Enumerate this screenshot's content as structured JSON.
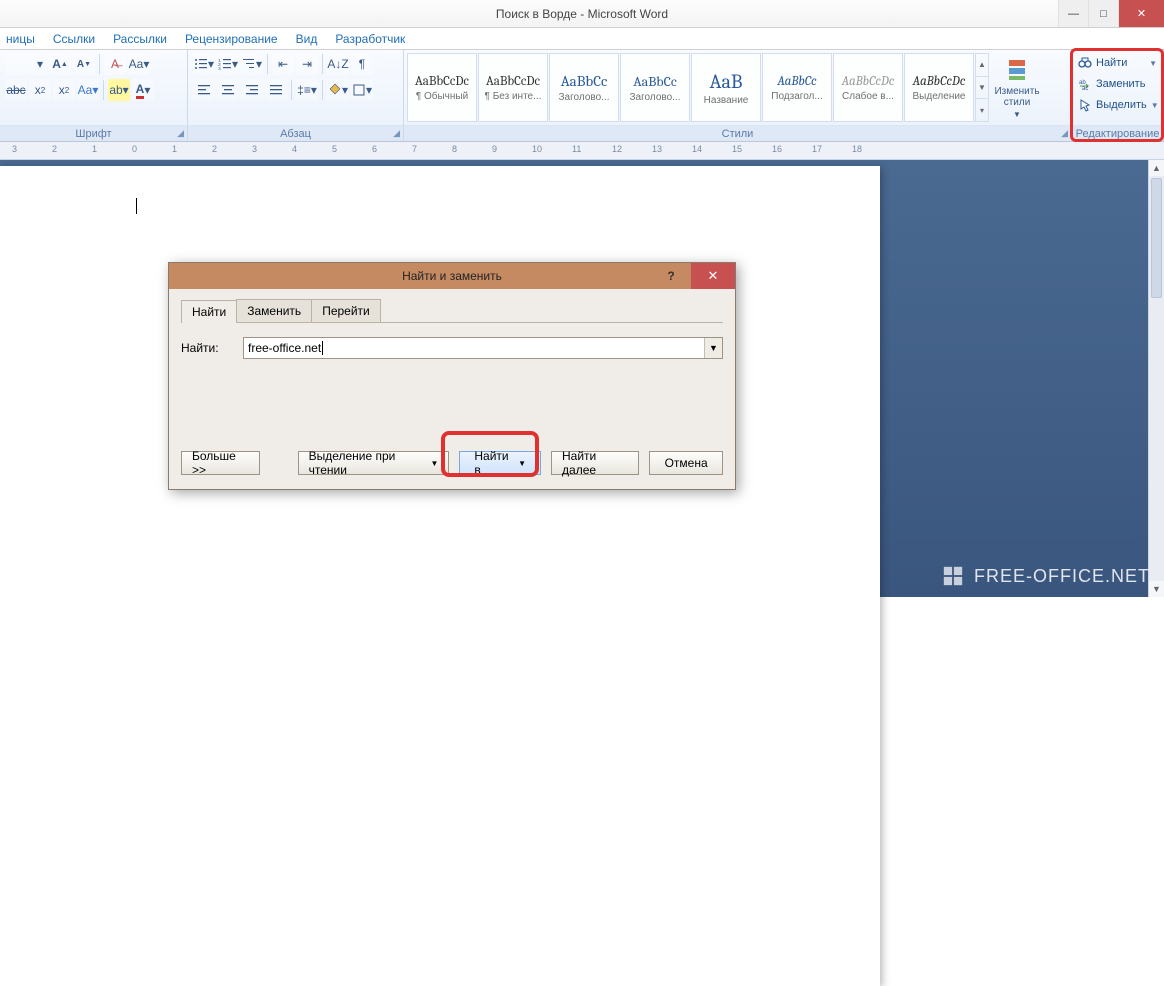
{
  "window": {
    "title": "Поиск в Ворде - Microsoft Word"
  },
  "tabs": {
    "t0": "ницы",
    "t1": "Ссылки",
    "t2": "Рассылки",
    "t3": "Рецензирование",
    "t4": "Вид",
    "t5": "Разработчик"
  },
  "groups": {
    "font": "Шрифт",
    "para": "Абзац",
    "styles": "Стили",
    "edit": "Редактирование"
  },
  "styles": {
    "s0": {
      "p": "AaBbCcDc",
      "l": "¶ Обычный"
    },
    "s1": {
      "p": "AaBbCcDc",
      "l": "¶ Без инте..."
    },
    "s2": {
      "p": "AaBbCc",
      "l": "Заголово..."
    },
    "s3": {
      "p": "AaBbCc",
      "l": "Заголово..."
    },
    "s4": {
      "p": "AaB",
      "l": "Название"
    },
    "s5": {
      "p": "AaBbCc",
      "l": "Подзагол..."
    },
    "s6": {
      "p": "AaBbCcDc",
      "l": "Слабое в..."
    },
    "s7": {
      "p": "AaBbCcDc",
      "l": "Выделение"
    },
    "change": "Изменить стили"
  },
  "edit": {
    "find": "Найти",
    "replace": "Заменить",
    "select": "Выделить"
  },
  "dialog": {
    "title": "Найти и заменить",
    "tab_find": "Найти",
    "tab_replace": "Заменить",
    "tab_goto": "Перейти",
    "label_find": "Найти:",
    "value": "free-office.net",
    "more": "Больше >>",
    "reading": "Выделение при чтении",
    "findin": "Найти в",
    "findnext": "Найти далее",
    "cancel": "Отмена"
  },
  "watermark": "FREE-OFFICE.NET"
}
